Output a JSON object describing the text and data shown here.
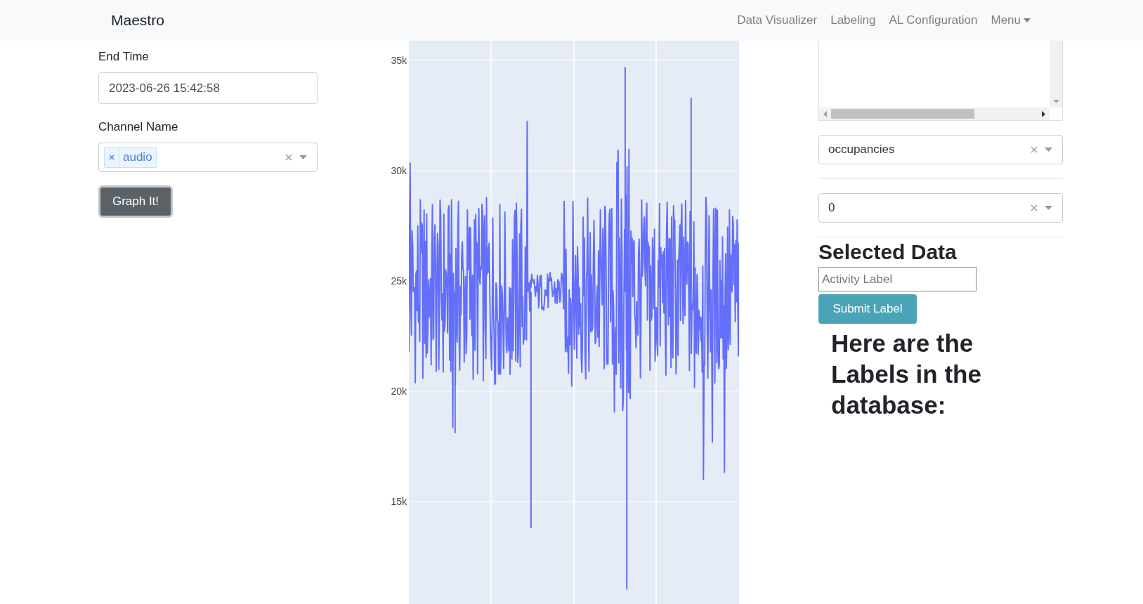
{
  "navbar": {
    "brand": "Maestro",
    "links": [
      {
        "label": "Data Visualizer"
      },
      {
        "label": "Labeling"
      },
      {
        "label": "AL Configuration"
      }
    ],
    "menu": {
      "label": "Menu"
    }
  },
  "query_form": {
    "end_time": {
      "label": "End Time",
      "value": "2023-06-26 15:42:58"
    },
    "channel": {
      "label": "Channel Name",
      "tags": [
        "audio"
      ]
    },
    "button": "Graph It!"
  },
  "chart": {
    "y_tick_labels": [
      "35k",
      "30k",
      "25k",
      "20k",
      "15k"
    ]
  },
  "labeling": {
    "selects": [
      {
        "value": "occupancies"
      },
      {
        "value": "0"
      }
    ],
    "heading": "Selected Data",
    "activity_input": {
      "placeholder": "Activity Label"
    },
    "submit_button": "Submit Label",
    "labels_heading": "Here are the Labels in the database:"
  }
}
